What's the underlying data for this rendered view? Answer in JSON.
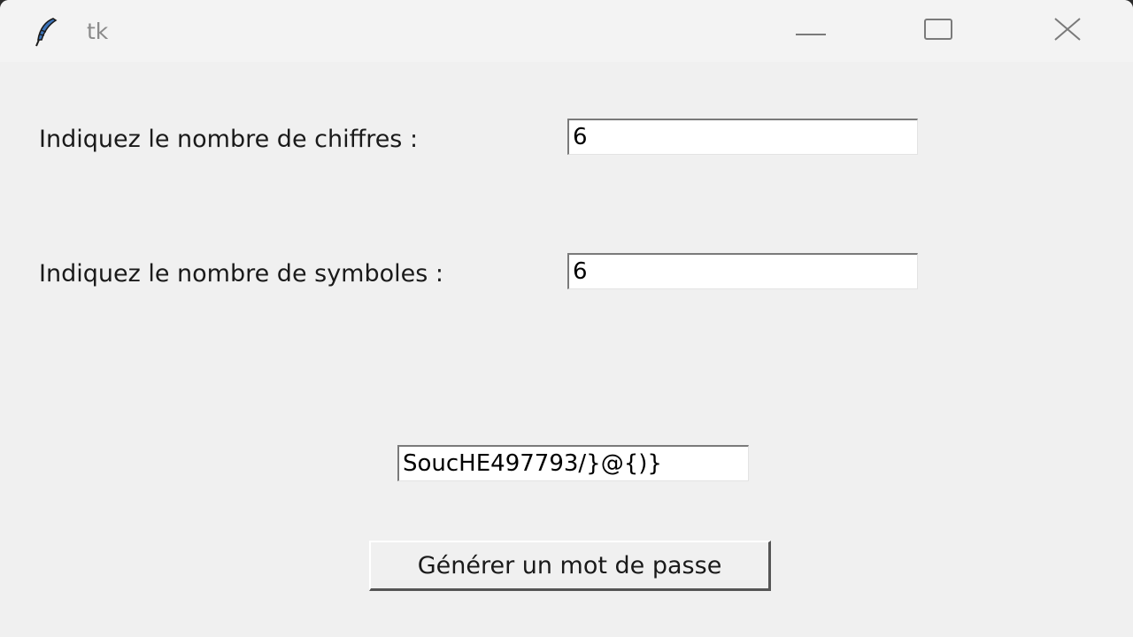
{
  "window": {
    "title": "tk",
    "icon": "tk-feather-icon",
    "controls": {
      "minimize": "minimize-icon",
      "maximize": "maximize-icon",
      "close": "close-icon"
    }
  },
  "form": {
    "digits_label": "Indiquez le nombre de chiffres :",
    "digits_value": "6",
    "symbols_label": "Indiquez le nombre de symboles :",
    "symbols_value": "6",
    "password_value": "SoucHE497793/}@{)}",
    "generate_label": "Générer un mot de passe"
  },
  "colors": {
    "background": "#f0f0f0",
    "titlebar": "#f3f3f3",
    "text": "#1a1a1a",
    "title_text": "#8a8a8a"
  }
}
